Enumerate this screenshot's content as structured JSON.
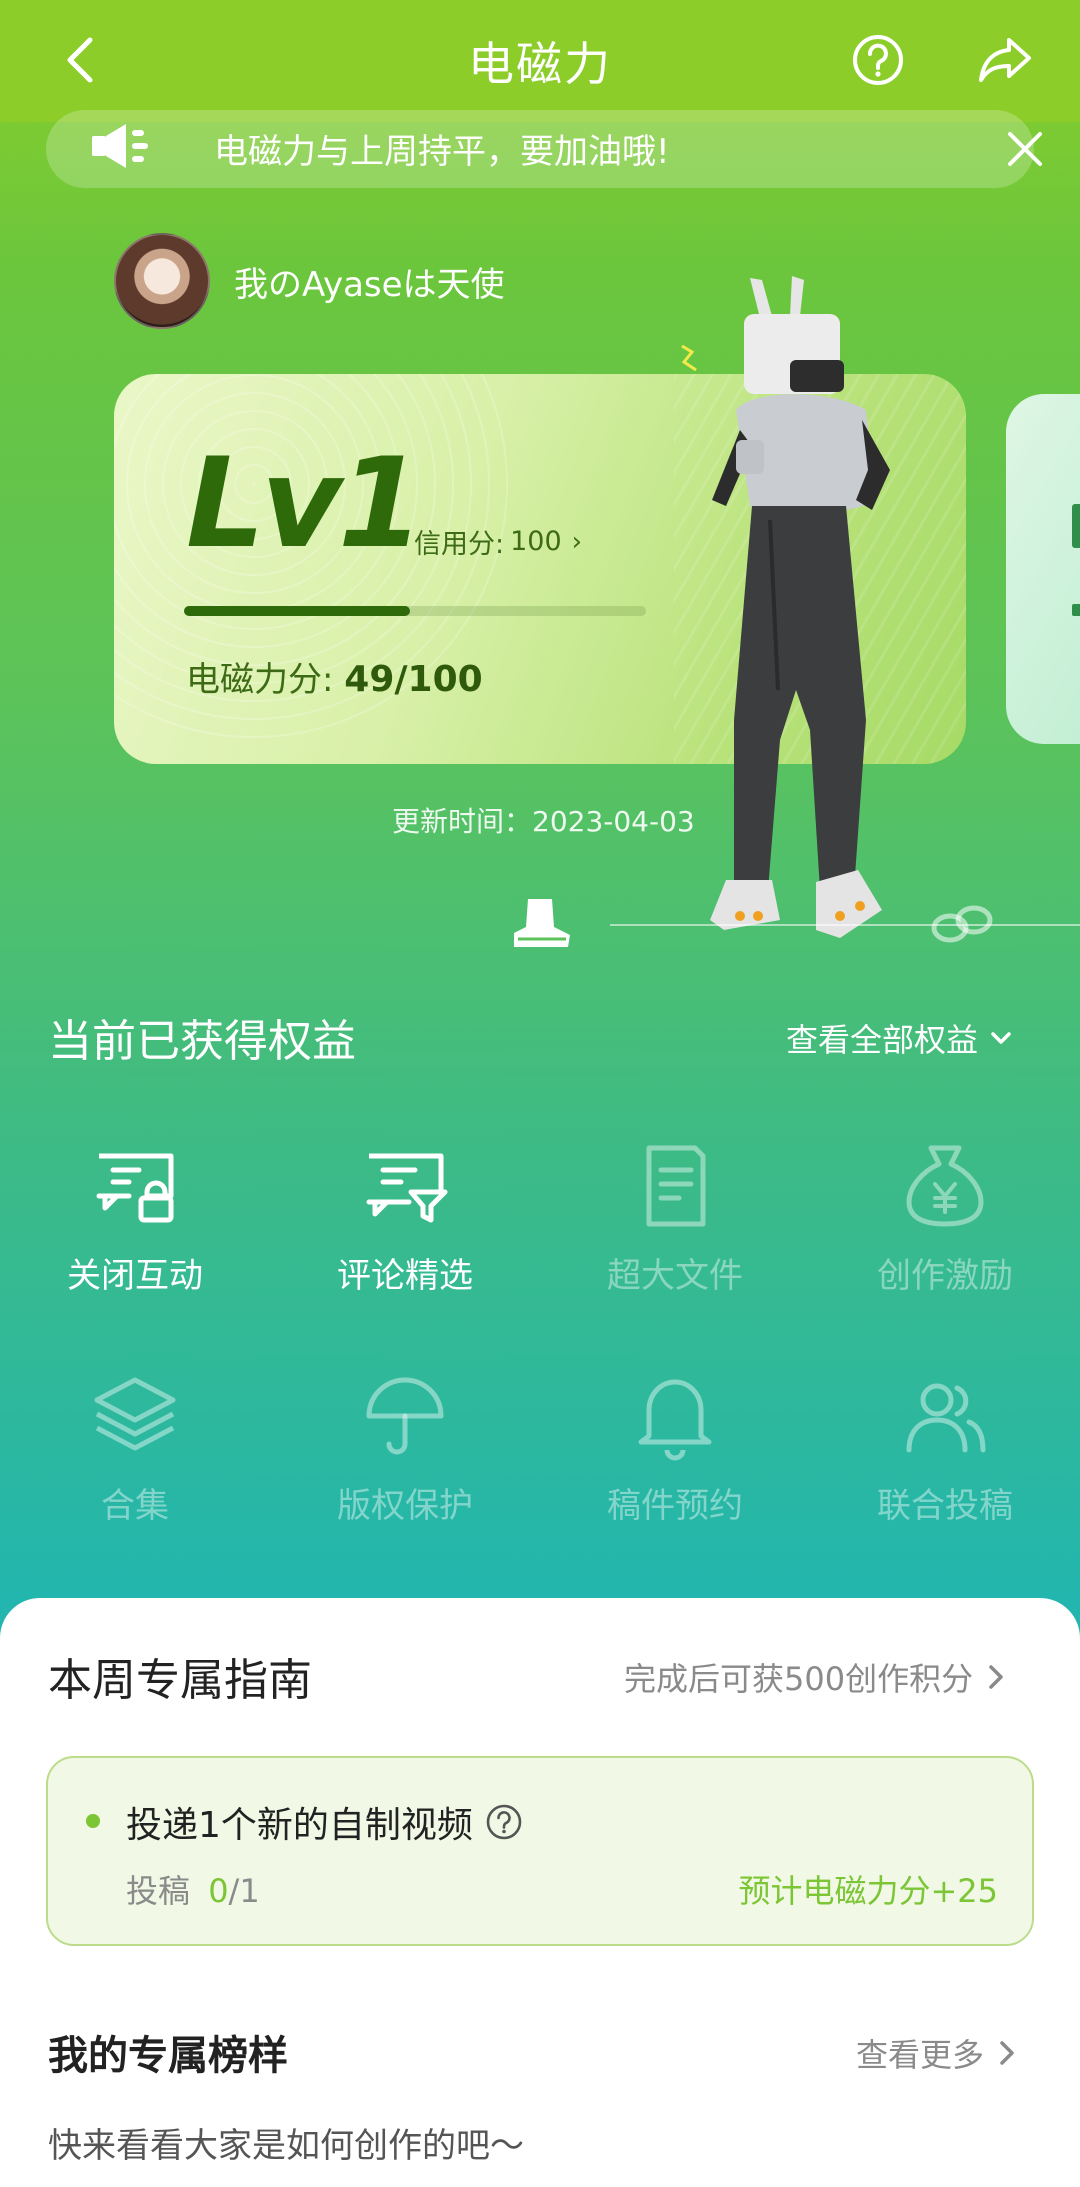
{
  "header": {
    "title": "电磁力",
    "back_icon": "back-arrow-icon",
    "help_icon": "help-circle-icon",
    "share_icon": "share-icon"
  },
  "notice": {
    "text": "电磁力与上周持平，要加油哦!",
    "icon": "speaker-icon",
    "close_icon": "close-icon"
  },
  "user": {
    "name": "我のAyaseは天使"
  },
  "level_card": {
    "level": "Lv1",
    "credit_label": "信用分:",
    "credit_value": "100",
    "progress_fraction": 0.49,
    "score_label": "电磁力分:",
    "score_value": "49/100"
  },
  "update_time": "更新时间：2023-04-03",
  "benefits": {
    "title": "当前已获得权益",
    "view_all": "查看全部权益",
    "items": [
      {
        "label": "关闭互动",
        "icon": "chat-lock-icon",
        "active": true
      },
      {
        "label": "评论精选",
        "icon": "chat-filter-icon",
        "active": true
      },
      {
        "label": "超大文件",
        "icon": "document-icon",
        "active": false
      },
      {
        "label": "创作激励",
        "icon": "money-bag-icon",
        "active": false
      },
      {
        "label": "合集",
        "icon": "layers-icon",
        "active": false
      },
      {
        "label": "版权保护",
        "icon": "umbrella-icon",
        "active": false
      },
      {
        "label": "稿件预约",
        "icon": "bell-icon",
        "active": false
      },
      {
        "label": "联合投稿",
        "icon": "users-icon",
        "active": false
      }
    ]
  },
  "weekly_guide": {
    "title": "本周专属指南",
    "link": "完成后可获500创作积分",
    "task": {
      "name": "投递1个新的自制视频",
      "progress_label": "投稿",
      "progress_done": "0",
      "progress_total": "/1",
      "reward": "预计电磁力分+25"
    }
  },
  "role_models": {
    "title": "我的专属榜样",
    "link": "查看更多",
    "desc": "快来看看大家是如何创作的吧～"
  },
  "colors": {
    "top_bar": "#8ccd2a",
    "level_text": "#2f6a0a",
    "accent_green": "#7cc535"
  }
}
